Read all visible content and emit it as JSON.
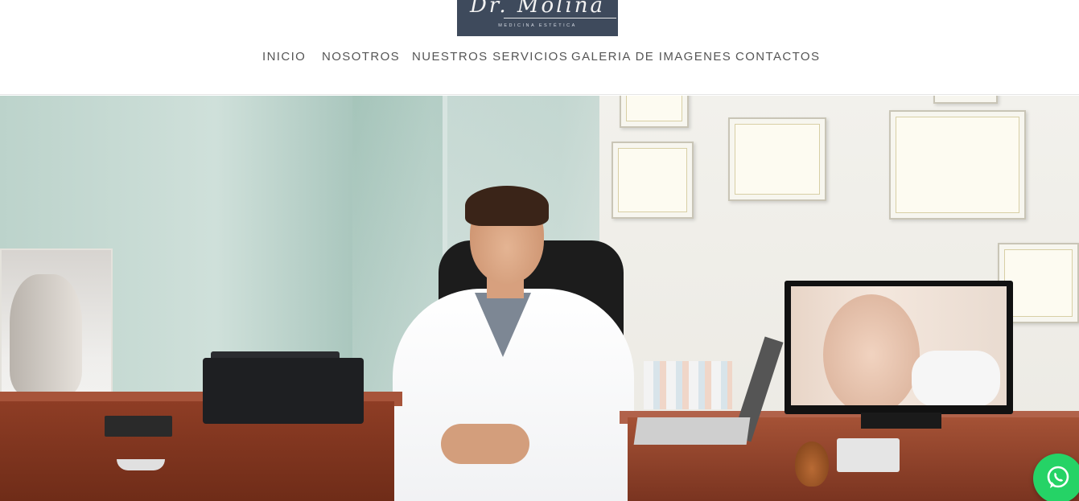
{
  "logo": {
    "script_text": "Dr. Molina",
    "subtitle": "MEDICINA ESTÉTICA",
    "bg_color": "#3e4a5c"
  },
  "nav": {
    "items": [
      {
        "label": "INICIO"
      },
      {
        "label": "NOSOTROS"
      },
      {
        "label": "NUESTROS SERVICIOS"
      },
      {
        "label": "GALERIA DE IMAGENES"
      },
      {
        "label": "CONTACTOS"
      }
    ]
  },
  "whatsapp": {
    "icon": "whatsapp-icon",
    "color": "#25d366"
  }
}
